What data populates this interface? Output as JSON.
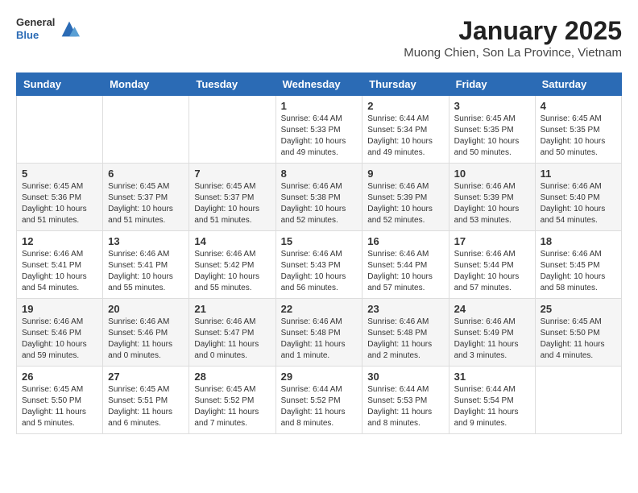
{
  "logo": {
    "general": "General",
    "blue": "Blue"
  },
  "title": "January 2025",
  "subtitle": "Muong Chien, Son La Province, Vietnam",
  "headers": [
    "Sunday",
    "Monday",
    "Tuesday",
    "Wednesday",
    "Thursday",
    "Friday",
    "Saturday"
  ],
  "weeks": [
    [
      {
        "day": "",
        "sunrise": "",
        "sunset": "",
        "daylight": ""
      },
      {
        "day": "",
        "sunrise": "",
        "sunset": "",
        "daylight": ""
      },
      {
        "day": "",
        "sunrise": "",
        "sunset": "",
        "daylight": ""
      },
      {
        "day": "1",
        "sunrise": "Sunrise: 6:44 AM",
        "sunset": "Sunset: 5:33 PM",
        "daylight": "Daylight: 10 hours and 49 minutes."
      },
      {
        "day": "2",
        "sunrise": "Sunrise: 6:44 AM",
        "sunset": "Sunset: 5:34 PM",
        "daylight": "Daylight: 10 hours and 49 minutes."
      },
      {
        "day": "3",
        "sunrise": "Sunrise: 6:45 AM",
        "sunset": "Sunset: 5:35 PM",
        "daylight": "Daylight: 10 hours and 50 minutes."
      },
      {
        "day": "4",
        "sunrise": "Sunrise: 6:45 AM",
        "sunset": "Sunset: 5:35 PM",
        "daylight": "Daylight: 10 hours and 50 minutes."
      }
    ],
    [
      {
        "day": "5",
        "sunrise": "Sunrise: 6:45 AM",
        "sunset": "Sunset: 5:36 PM",
        "daylight": "Daylight: 10 hours and 51 minutes."
      },
      {
        "day": "6",
        "sunrise": "Sunrise: 6:45 AM",
        "sunset": "Sunset: 5:37 PM",
        "daylight": "Daylight: 10 hours and 51 minutes."
      },
      {
        "day": "7",
        "sunrise": "Sunrise: 6:45 AM",
        "sunset": "Sunset: 5:37 PM",
        "daylight": "Daylight: 10 hours and 51 minutes."
      },
      {
        "day": "8",
        "sunrise": "Sunrise: 6:46 AM",
        "sunset": "Sunset: 5:38 PM",
        "daylight": "Daylight: 10 hours and 52 minutes."
      },
      {
        "day": "9",
        "sunrise": "Sunrise: 6:46 AM",
        "sunset": "Sunset: 5:39 PM",
        "daylight": "Daylight: 10 hours and 52 minutes."
      },
      {
        "day": "10",
        "sunrise": "Sunrise: 6:46 AM",
        "sunset": "Sunset: 5:39 PM",
        "daylight": "Daylight: 10 hours and 53 minutes."
      },
      {
        "day": "11",
        "sunrise": "Sunrise: 6:46 AM",
        "sunset": "Sunset: 5:40 PM",
        "daylight": "Daylight: 10 hours and 54 minutes."
      }
    ],
    [
      {
        "day": "12",
        "sunrise": "Sunrise: 6:46 AM",
        "sunset": "Sunset: 5:41 PM",
        "daylight": "Daylight: 10 hours and 54 minutes."
      },
      {
        "day": "13",
        "sunrise": "Sunrise: 6:46 AM",
        "sunset": "Sunset: 5:41 PM",
        "daylight": "Daylight: 10 hours and 55 minutes."
      },
      {
        "day": "14",
        "sunrise": "Sunrise: 6:46 AM",
        "sunset": "Sunset: 5:42 PM",
        "daylight": "Daylight: 10 hours and 55 minutes."
      },
      {
        "day": "15",
        "sunrise": "Sunrise: 6:46 AM",
        "sunset": "Sunset: 5:43 PM",
        "daylight": "Daylight: 10 hours and 56 minutes."
      },
      {
        "day": "16",
        "sunrise": "Sunrise: 6:46 AM",
        "sunset": "Sunset: 5:44 PM",
        "daylight": "Daylight: 10 hours and 57 minutes."
      },
      {
        "day": "17",
        "sunrise": "Sunrise: 6:46 AM",
        "sunset": "Sunset: 5:44 PM",
        "daylight": "Daylight: 10 hours and 57 minutes."
      },
      {
        "day": "18",
        "sunrise": "Sunrise: 6:46 AM",
        "sunset": "Sunset: 5:45 PM",
        "daylight": "Daylight: 10 hours and 58 minutes."
      }
    ],
    [
      {
        "day": "19",
        "sunrise": "Sunrise: 6:46 AM",
        "sunset": "Sunset: 5:46 PM",
        "daylight": "Daylight: 10 hours and 59 minutes."
      },
      {
        "day": "20",
        "sunrise": "Sunrise: 6:46 AM",
        "sunset": "Sunset: 5:46 PM",
        "daylight": "Daylight: 11 hours and 0 minutes."
      },
      {
        "day": "21",
        "sunrise": "Sunrise: 6:46 AM",
        "sunset": "Sunset: 5:47 PM",
        "daylight": "Daylight: 11 hours and 0 minutes."
      },
      {
        "day": "22",
        "sunrise": "Sunrise: 6:46 AM",
        "sunset": "Sunset: 5:48 PM",
        "daylight": "Daylight: 11 hours and 1 minute."
      },
      {
        "day": "23",
        "sunrise": "Sunrise: 6:46 AM",
        "sunset": "Sunset: 5:48 PM",
        "daylight": "Daylight: 11 hours and 2 minutes."
      },
      {
        "day": "24",
        "sunrise": "Sunrise: 6:46 AM",
        "sunset": "Sunset: 5:49 PM",
        "daylight": "Daylight: 11 hours and 3 minutes."
      },
      {
        "day": "25",
        "sunrise": "Sunrise: 6:45 AM",
        "sunset": "Sunset: 5:50 PM",
        "daylight": "Daylight: 11 hours and 4 minutes."
      }
    ],
    [
      {
        "day": "26",
        "sunrise": "Sunrise: 6:45 AM",
        "sunset": "Sunset: 5:50 PM",
        "daylight": "Daylight: 11 hours and 5 minutes."
      },
      {
        "day": "27",
        "sunrise": "Sunrise: 6:45 AM",
        "sunset": "Sunset: 5:51 PM",
        "daylight": "Daylight: 11 hours and 6 minutes."
      },
      {
        "day": "28",
        "sunrise": "Sunrise: 6:45 AM",
        "sunset": "Sunset: 5:52 PM",
        "daylight": "Daylight: 11 hours and 7 minutes."
      },
      {
        "day": "29",
        "sunrise": "Sunrise: 6:44 AM",
        "sunset": "Sunset: 5:52 PM",
        "daylight": "Daylight: 11 hours and 8 minutes."
      },
      {
        "day": "30",
        "sunrise": "Sunrise: 6:44 AM",
        "sunset": "Sunset: 5:53 PM",
        "daylight": "Daylight: 11 hours and 8 minutes."
      },
      {
        "day": "31",
        "sunrise": "Sunrise: 6:44 AM",
        "sunset": "Sunset: 5:54 PM",
        "daylight": "Daylight: 11 hours and 9 minutes."
      },
      {
        "day": "",
        "sunrise": "",
        "sunset": "",
        "daylight": ""
      }
    ]
  ]
}
